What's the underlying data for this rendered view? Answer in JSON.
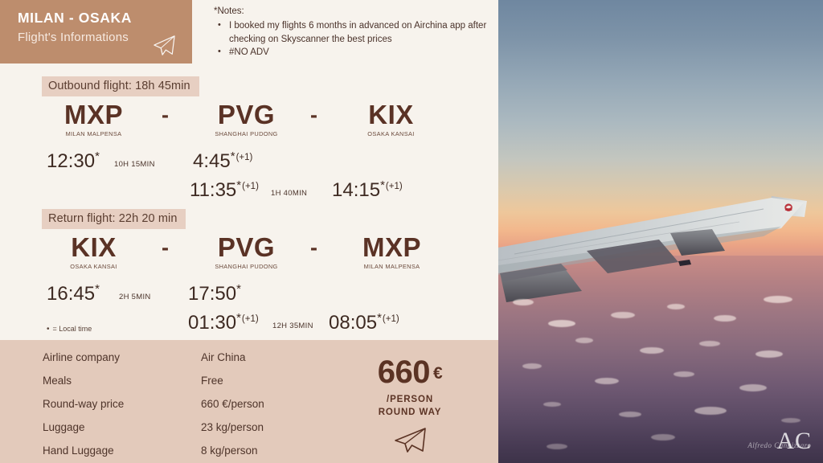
{
  "header": {
    "title": "MILAN - OSAKA",
    "subtitle": "Flight's Informations",
    "icon": "paper-plane-icon",
    "bg_color": "#bd8d6d"
  },
  "notes": {
    "title": "*Notes:",
    "items": [
      "I booked my flights 6 months in advanced on Airchina app after checking on Skyscanner the best prices",
      "#NO ADV"
    ]
  },
  "outbound": {
    "label": "Outbound flight: 18h 45min",
    "airports": [
      {
        "code": "MXP",
        "name": "MILAN MALPENSA"
      },
      {
        "code": "PVG",
        "name": "SHANGHAI PUDONG"
      },
      {
        "code": "KIX",
        "name": "OSAKA KANSAI"
      }
    ],
    "separator": "-",
    "times": {
      "depart1": "12:30",
      "depart1_star": "*",
      "arrive1": "4:45",
      "arrive1_star": "*",
      "arrive1_day": "(+1)",
      "depart2": "11:35",
      "depart2_star": "*",
      "depart2_day": "(+1)",
      "arrive2": "14:15",
      "arrive2_star": "*",
      "arrive2_day": "(+1)"
    },
    "durations": {
      "leg1": "10H 15MIN",
      "leg2": "1H 40MIN"
    }
  },
  "return": {
    "label": "Return flight: 22h 20 min",
    "airports": [
      {
        "code": "KIX",
        "name": "OSAKA KANSAI"
      },
      {
        "code": "PVG",
        "name": "SHANGHAI PUDONG"
      },
      {
        "code": "MXP",
        "name": "MILAN MALPENSA"
      }
    ],
    "separator": "-",
    "times": {
      "depart1": "16:45",
      "depart1_star": "*",
      "arrive1": "17:50",
      "arrive1_star": "*",
      "depart2": "01:30",
      "depart2_star": "*",
      "depart2_day": "(+1)",
      "arrive2": "08:05",
      "arrive2_star": "*",
      "arrive2_day": "(+1)"
    },
    "durations": {
      "leg1": "2H 5MIN",
      "leg2": "12H 35MIN"
    }
  },
  "legend": {
    "marker": "•",
    "text": "= Local time"
  },
  "details_table": {
    "rows": [
      {
        "key": "Airline company",
        "value": "Air China"
      },
      {
        "key": "Meals",
        "value": "Free"
      },
      {
        "key": "Round-way price",
        "value": "660 €/person"
      },
      {
        "key": "Luggage",
        "value": "23 kg/person"
      },
      {
        "key": "Hand Luggage",
        "value": "8  kg/person"
      }
    ]
  },
  "price": {
    "amount": "660",
    "currency": "€",
    "line1": "/PERSON",
    "line2": "ROUND WAY",
    "icon": "paper-plane-icon"
  },
  "photo": {
    "alt": "airplane-wing-sunset-photo",
    "watermark_initials": "AC",
    "watermark_script": "Alfredo Cannizzaro"
  },
  "colors": {
    "page_bg": "#f7f3ed",
    "lower_bg": "#e3cabb",
    "accent_brown": "#bd8d6d",
    "label_bg": "#e7cfc2",
    "text_dark": "#5a3225"
  }
}
